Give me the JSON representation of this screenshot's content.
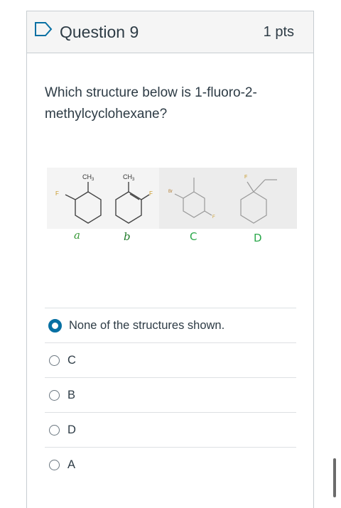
{
  "question": {
    "title": "Question 9",
    "points": "1 pts",
    "text": "Which structure below is 1-fluoro-2-methylcyclohexane?"
  },
  "figure": {
    "labels": {
      "a": "a",
      "b": "b",
      "c": "C",
      "d": "D"
    },
    "atoms": {
      "ch3": "CH",
      "ch3_sub": "3",
      "f": "F",
      "br": "Br"
    }
  },
  "answers": [
    {
      "label": "None of the structures shown.",
      "selected": true
    },
    {
      "label": "C",
      "selected": false
    },
    {
      "label": "B",
      "selected": false
    },
    {
      "label": "D",
      "selected": false
    },
    {
      "label": "A",
      "selected": false
    }
  ],
  "colors": {
    "accent": "#0770a3",
    "handwriting_a": "#3a9a3a",
    "handwriting_b": "#1f7a2a",
    "handwriting_c": "#2aa84a"
  }
}
